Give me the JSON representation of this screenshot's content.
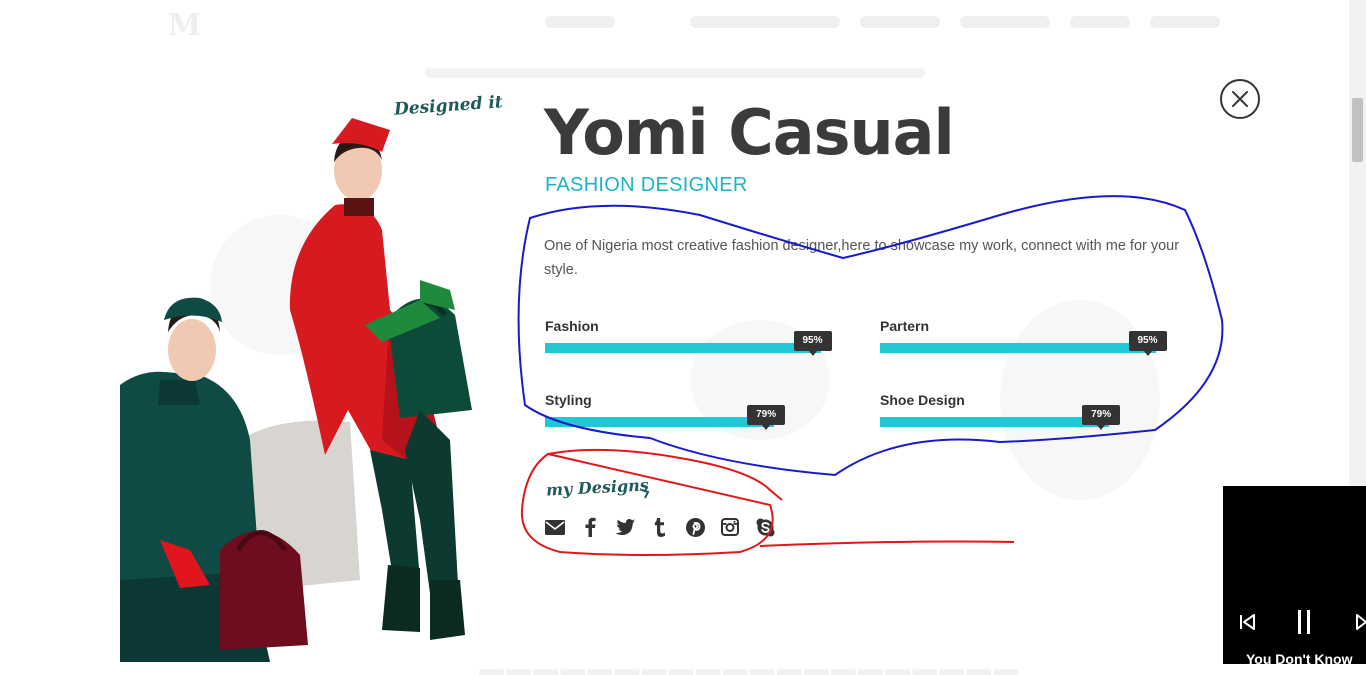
{
  "profile": {
    "name": "Yomi Casual",
    "role": "FASHION DESIGNER",
    "bio": "One of Nigeria most creative fashion designer,here to showcase my work, connect with me for your style.",
    "tagline": "Designed it"
  },
  "skills": [
    {
      "label": "Fashion",
      "percent": 95,
      "badge": "95%"
    },
    {
      "label": "Partern",
      "percent": 95,
      "badge": "95%"
    },
    {
      "label": "Styling",
      "percent": 79,
      "badge": "79%"
    },
    {
      "label": "Shoe Design",
      "percent": 79,
      "badge": "79%"
    }
  ],
  "designs": {
    "label": "my Designs",
    "social_icons": [
      "envelope-icon",
      "facebook-icon",
      "twitter-icon",
      "tumblr-icon",
      "pinterest-icon",
      "instagram-icon",
      "skype-icon"
    ]
  },
  "close": {
    "icon": "close-icon"
  },
  "player": {
    "title": "You Don't Know",
    "controls": [
      "previous-icon",
      "pause-icon",
      "next-icon"
    ]
  },
  "colors": {
    "accent": "#22c7d6",
    "heading": "#3b3b3b",
    "badge": "#333333",
    "annotation_blue": "#1a1acc",
    "annotation_red": "#e01818"
  }
}
